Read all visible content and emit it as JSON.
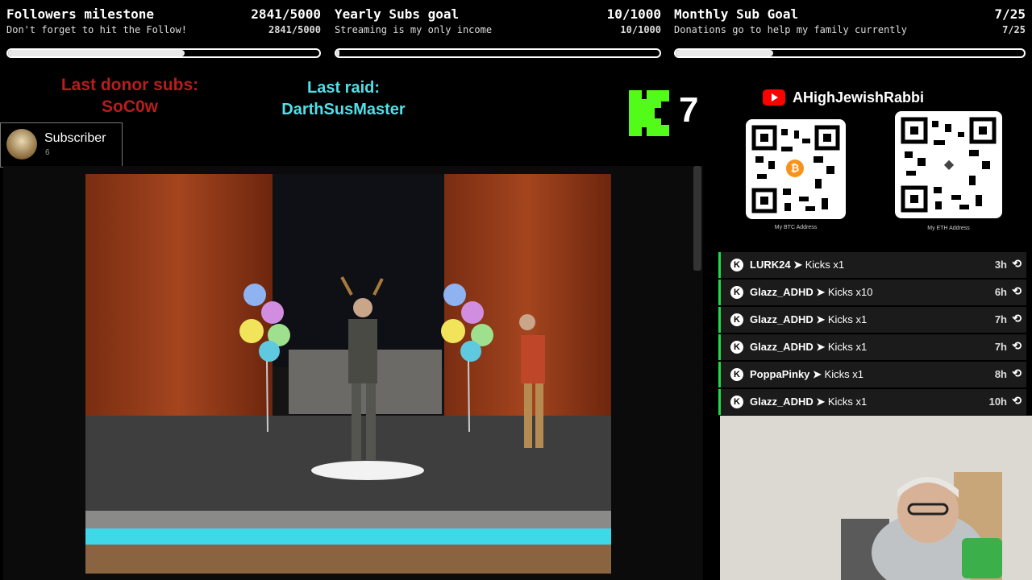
{
  "goals": [
    {
      "title": "Followers milestone",
      "count": "2841/5000",
      "subtitle": "Don't forget to hit the Follow!",
      "count_small": "2841/5000",
      "progress": 0.568
    },
    {
      "title": "Yearly Subs goal",
      "count": "10/1000",
      "subtitle": "Streaming is my only income",
      "count_small": "10/1000",
      "progress": 0.01
    },
    {
      "title": "Monthly Sub Goal",
      "count": "7/25",
      "subtitle": "Donations go to help my family currently",
      "count_small": "7/25",
      "progress": 0.28
    }
  ],
  "donor": {
    "label": "Last donor subs:",
    "name": "SoC0w"
  },
  "raid": {
    "label": "Last raid:",
    "name": "DarthSusMaster"
  },
  "kick_counter": {
    "value": "7",
    "accent": "#53fc18"
  },
  "subscriber": {
    "label": "Subscriber",
    "count": "6"
  },
  "youtube": {
    "channel": "AHighJewishRabbi",
    "accent": "#ff0000"
  },
  "qr": [
    {
      "label": "My BTC Address",
      "coin_icon": "bitcoin-icon"
    },
    {
      "label": "My ETH Address",
      "coin_icon": "ethereum-icon"
    }
  ],
  "kicks": [
    {
      "user": "LURK24",
      "amount": "Kicks x1",
      "time": "3h"
    },
    {
      "user": "Glazz_ADHD",
      "amount": "Kicks x10",
      "time": "6h"
    },
    {
      "user": "Glazz_ADHD",
      "amount": "Kicks x1",
      "time": "7h"
    },
    {
      "user": "Glazz_ADHD",
      "amount": "Kicks x1",
      "time": "7h"
    },
    {
      "user": "PoppaPinky",
      "amount": "Kicks x1",
      "time": "8h"
    },
    {
      "user": "Glazz_ADHD",
      "amount": "Kicks x1",
      "time": "10h"
    }
  ],
  "colors": {
    "donor": "#b81d1d",
    "raid": "#4fe0e8",
    "kick_green": "#1fd94a"
  }
}
